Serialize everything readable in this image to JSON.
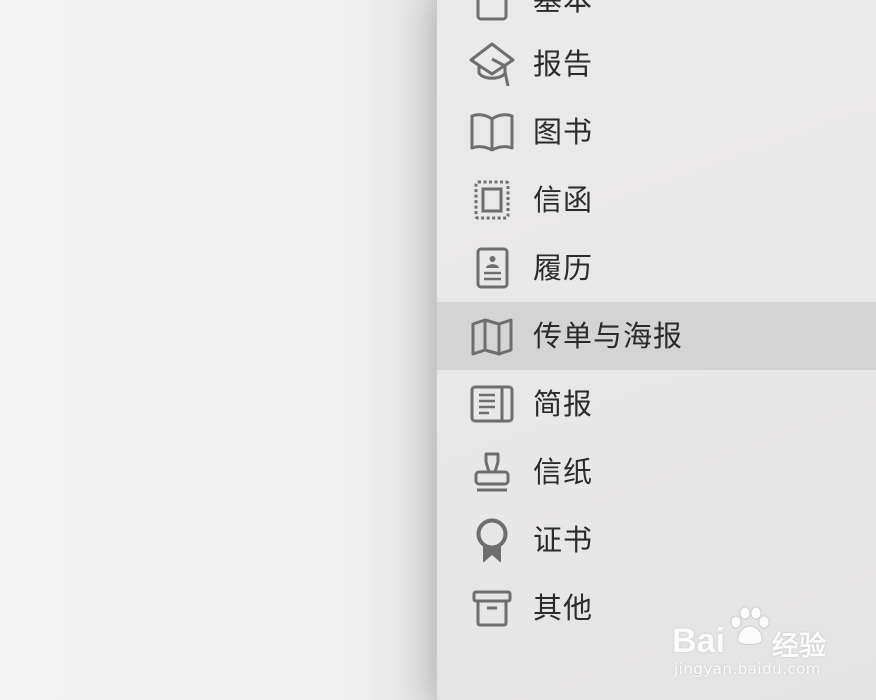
{
  "sidebar": {
    "items": [
      {
        "label": "基本",
        "icon": "document-icon",
        "selected": false
      },
      {
        "label": "报告",
        "icon": "graduation-cap-icon",
        "selected": false
      },
      {
        "label": "图书",
        "icon": "open-book-icon",
        "selected": false
      },
      {
        "label": "信函",
        "icon": "stamp-frame-icon",
        "selected": false
      },
      {
        "label": "履历",
        "icon": "id-card-icon",
        "selected": false
      },
      {
        "label": "传单与海报",
        "icon": "map-icon",
        "selected": true
      },
      {
        "label": "简报",
        "icon": "newspaper-icon",
        "selected": false
      },
      {
        "label": "信纸",
        "icon": "rubber-stamp-icon",
        "selected": false
      },
      {
        "label": "证书",
        "icon": "award-ribbon-icon",
        "selected": false
      },
      {
        "label": "其他",
        "icon": "archive-box-icon",
        "selected": false
      }
    ]
  },
  "watermark": {
    "brand": "Bai",
    "brand_tail": "经验",
    "url": "jingyan.baidu.com"
  },
  "colors": {
    "sidebar_bg": "#e9e8e8",
    "selected_bg": "#d5d4d4",
    "icon": "#6e6e6e",
    "label": "#2b2b2b"
  }
}
